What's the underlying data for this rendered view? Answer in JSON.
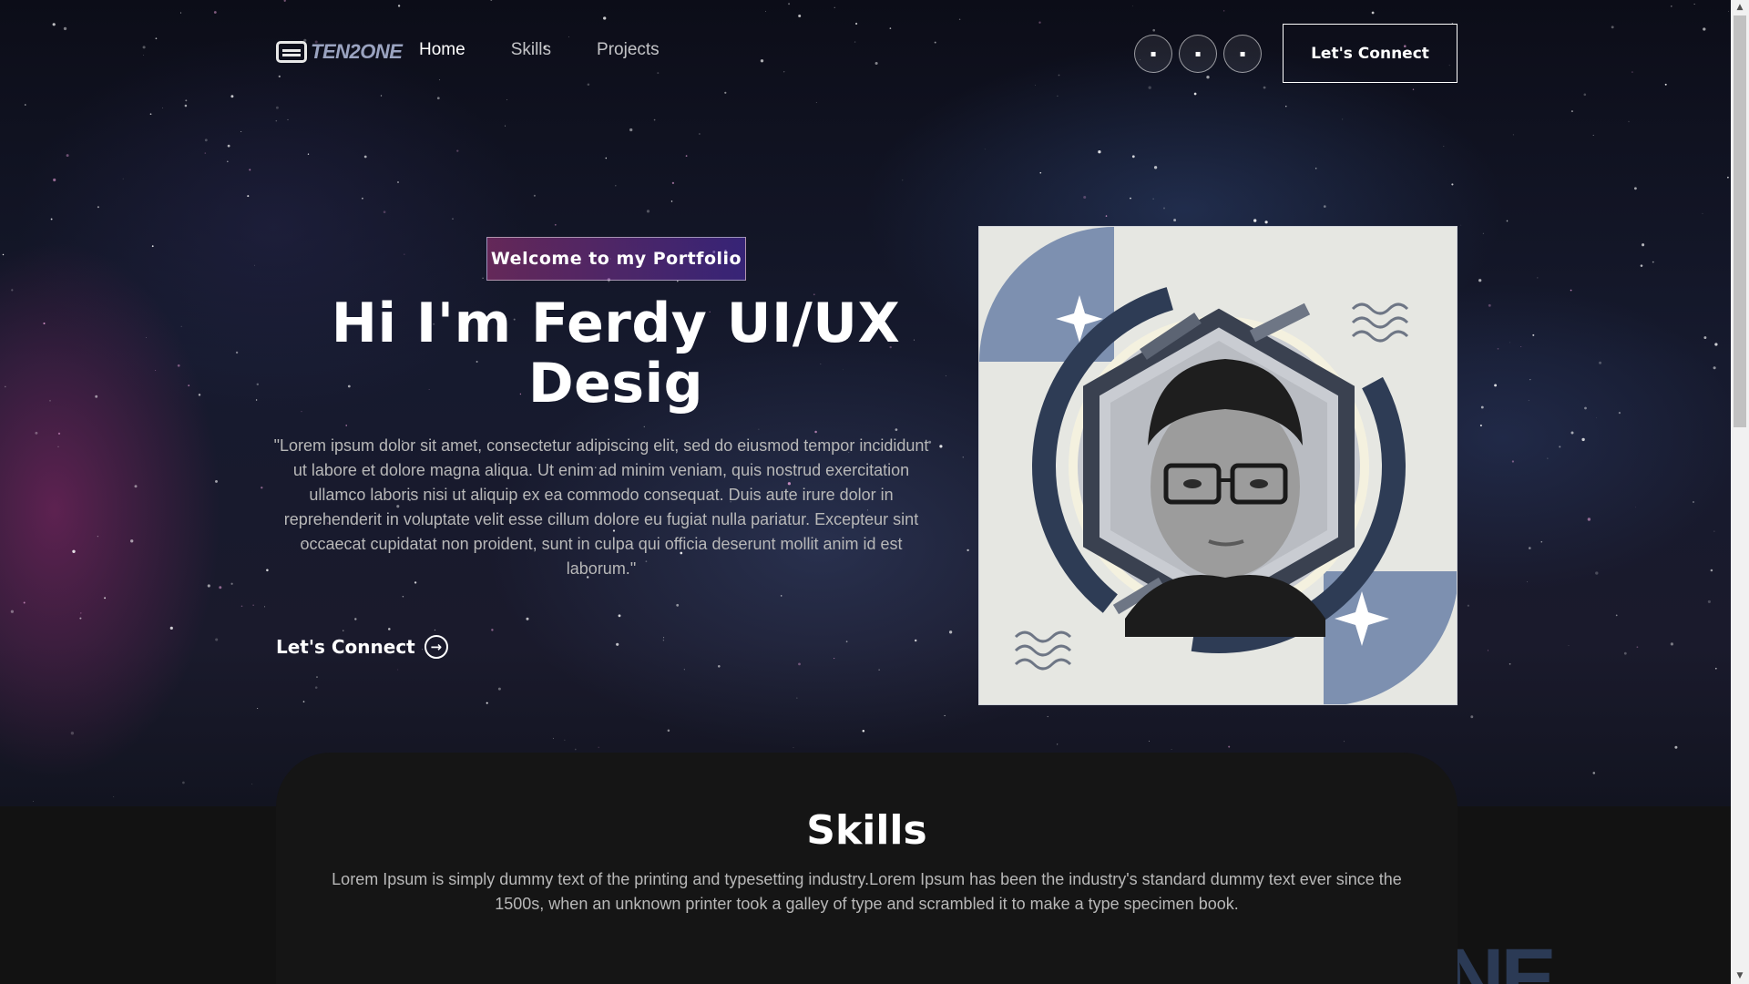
{
  "nav": {
    "logo_text": "TEN2ONE",
    "links": [
      {
        "label": "Home",
        "active": true
      },
      {
        "label": "Skills",
        "active": false
      },
      {
        "label": "Projects",
        "active": false
      }
    ],
    "social_icons": [
      "linkedin-icon",
      "facebook-icon",
      "instagram-icon"
    ],
    "connect_label": "Let's Connect"
  },
  "hero": {
    "tagline": "Welcome to my Portfolio",
    "title_line1": "Hi I'm Ferdy UI/UX",
    "title_line2": "Desig",
    "description": "\"Lorem ipsum dolor sit amet, consectetur adipiscing elit, sed do eiusmod tempor incididunt ut labore et dolore magna aliqua. Ut enim ad minim veniam, quis nostrud exercitation ullamco laboris nisi ut aliquip ex ea commodo consequat. Duis aute irure dolor in reprehenderit in voluptate velit esse cillum dolore eu fugiat nulla pariatur. Excepteur sint occaecat cupidatat non proident, sunt in culpa qui officia deserunt mollit anim id est laborum.\"",
    "connect_label": "Let's Connect"
  },
  "skills": {
    "title": "Skills",
    "description": "Lorem Ipsum is simply dummy text of the printing and typesetting industry.Lorem Ipsum has been the industry's standard dummy text ever since the 1500s, when an unknown printer took a galley of type and scrambled it to make a type specimen book.",
    "background_letters": "NE"
  },
  "colors": {
    "page_bg": "#121212",
    "tagline_gradient_start": "#aa367c",
    "tagline_gradient_end": "#4a2fbd",
    "frame_navy": "#2e3c55",
    "frame_blue": "#7d90b0"
  }
}
